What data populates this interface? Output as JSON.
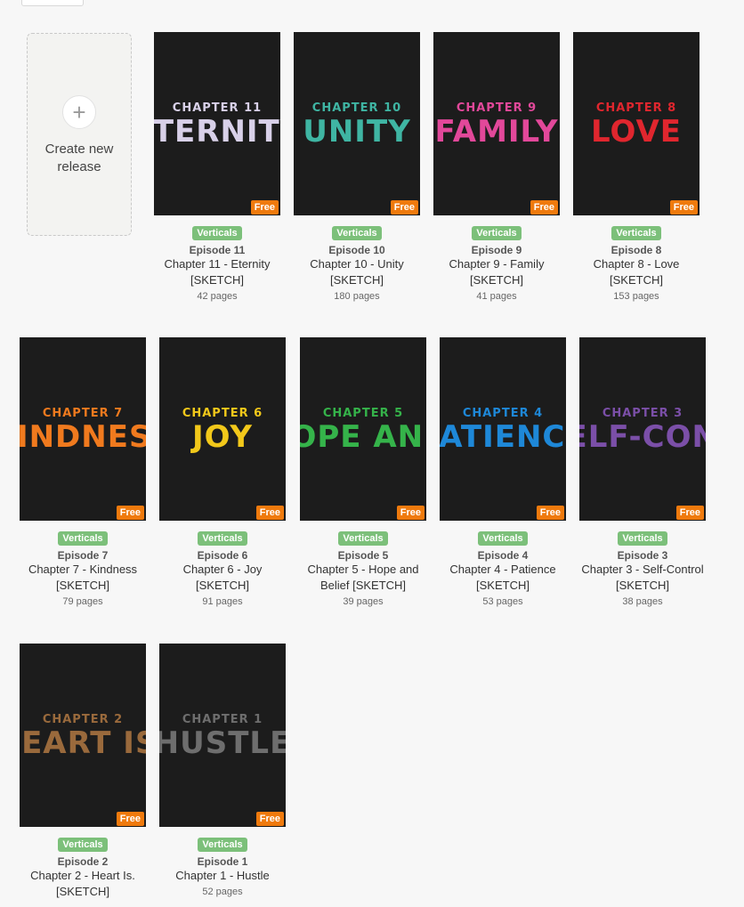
{
  "create": {
    "label": "Create new release",
    "icon": "plus-icon"
  },
  "badge_free": "Free",
  "episodes": [
    {
      "chapter": "CHAPTER 11",
      "word": "ETERNITY",
      "color": "#d8d0e8",
      "type": "Verticals",
      "episode": "Episode 11",
      "title": "Chapter 11 - Eternity [SKETCH]",
      "pages": "42 pages"
    },
    {
      "chapter": "CHAPTER 10",
      "word": "UNITY",
      "color": "#3fb5a3",
      "type": "Verticals",
      "episode": "Episode 10",
      "title": "Chapter 10 - Unity [SKETCH]",
      "pages": "180 pages"
    },
    {
      "chapter": "CHAPTER 9",
      "word": "FAMILY",
      "color": "#e2489a",
      "type": "Verticals",
      "episode": "Episode 9",
      "title": "Chapter 9 - Family [SKETCH]",
      "pages": "41 pages"
    },
    {
      "chapter": "CHAPTER 8",
      "word": "LOVE",
      "color": "#e0262e",
      "type": "Verticals",
      "episode": "Episode 8",
      "title": "Chapter 8 - Love [SKETCH]",
      "pages": "153 pages"
    },
    {
      "chapter": "CHAPTER 7",
      "word": "KINDNESS",
      "color": "#f07a1e",
      "type": "Verticals",
      "episode": "Episode 7",
      "title": "Chapter 7 - Kindness [SKETCH]",
      "pages": "79 pages"
    },
    {
      "chapter": "CHAPTER 6",
      "word": "JOY",
      "color": "#f2c81a",
      "type": "Verticals",
      "episode": "Episode 6",
      "title": "Chapter 6 - Joy [SKETCH]",
      "pages": "91 pages"
    },
    {
      "chapter": "CHAPTER 5",
      "word": "HOPE AND BELIEF",
      "color": "#35b34a",
      "type": "Verticals",
      "episode": "Episode 5",
      "title": "Chapter 5 - Hope and Belief [SKETCH]",
      "pages": "39 pages"
    },
    {
      "chapter": "CHAPTER 4",
      "word": "PATIENCE",
      "color": "#1e88d8",
      "type": "Verticals",
      "episode": "Episode 4",
      "title": "Chapter 4 - Patience [SKETCH]",
      "pages": "53 pages"
    },
    {
      "chapter": "CHAPTER 3",
      "word": "SELF-CONTROL",
      "color": "#7b4fa8",
      "type": "Verticals",
      "episode": "Episode 3",
      "title": "Chapter 3 - Self-Control [SKETCH]",
      "pages": "38 pages"
    },
    {
      "chapter": "CHAPTER 2",
      "word": "HEART IS.",
      "color": "#9a6a3c",
      "type": "Verticals",
      "episode": "Episode 2",
      "title": "Chapter 2 - Heart Is. [SKETCH]",
      "pages": ""
    },
    {
      "chapter": "CHAPTER 1",
      "word": "HUSTLE",
      "color": "#6e6e6e",
      "type": "Verticals",
      "episode": "Episode 1",
      "title": "Chapter 1 - Hustle",
      "pages": "52 pages"
    }
  ]
}
